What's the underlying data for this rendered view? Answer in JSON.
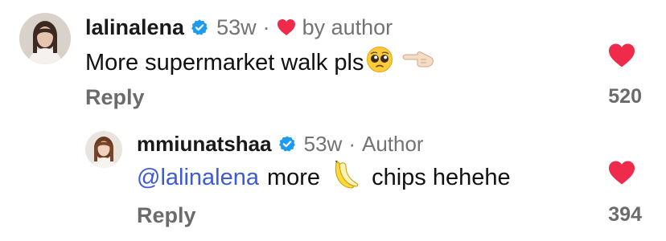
{
  "comments": [
    {
      "username": "lalinalena",
      "age": "53w",
      "badge": "by author",
      "text": "More supermarket walk pls",
      "emoji": [
        "pleading-face",
        "left-pointing-hand"
      ],
      "reply_label": "Reply",
      "like_count": "520"
    },
    {
      "username": "mmiunatshaa",
      "age": "53w",
      "badge": "Author",
      "mention": "@lalinalena",
      "text_part1": "more",
      "emoji": [
        "banana"
      ],
      "text_part2": "chips hehehe",
      "reply_label": "Reply",
      "like_count": "394"
    }
  ],
  "colors": {
    "heart": "#ef2a4a",
    "verified": "#1d9bf0",
    "mention": "#3e5bd6",
    "meta": "#737373"
  }
}
